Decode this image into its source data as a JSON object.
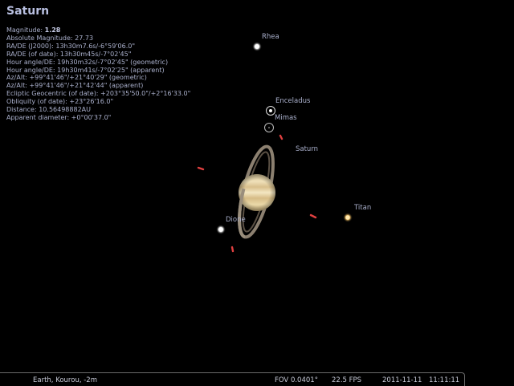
{
  "object": {
    "name": "Saturn",
    "magnitude_label": "Magnitude: ",
    "magnitude_value": "1.28",
    "details": [
      "Absolute Magnitude: 27.73",
      "RA/DE (J2000): 13h30m7.6s/-6°59'06.0\"",
      "RA/DE (of date): 13h30m45s/-7°02'45\"",
      "Hour angle/DE: 19h30m32s/-7°02'45\" (geometric)",
      "Hour angle/DE: 19h30m41s/-7°02'25\" (apparent)",
      "Az/Alt: +99°41'46\"/+21°40'29\" (geometric)",
      "Az/Alt: +99°41'46\"/+21°42'44\" (apparent)",
      "Ecliptic Geocentric (of date): +203°35'50.0\"/+2°16'33.0\"",
      "Obliquity (of date): +23°26'16.0\"",
      "Distance: 10.56498882AU",
      "Apparent diameter: +0°00'37.0\""
    ]
  },
  "labels": {
    "rhea": "Rhea",
    "enceladus": "Enceladus",
    "mimas": "Mimas",
    "saturn": "Saturn",
    "titan": "Titan",
    "dione": "Dione"
  },
  "status_bar": {
    "location": "Earth, Kourou, -2m",
    "fov": "FOV 0.0401°",
    "fps": "22.5 FPS",
    "date": "2011-11-11",
    "time": "11:11:11"
  },
  "colors": {
    "background": "#000000",
    "text": "#aab0cc",
    "planet": "#e6d2a0",
    "marker": "#e04040"
  }
}
